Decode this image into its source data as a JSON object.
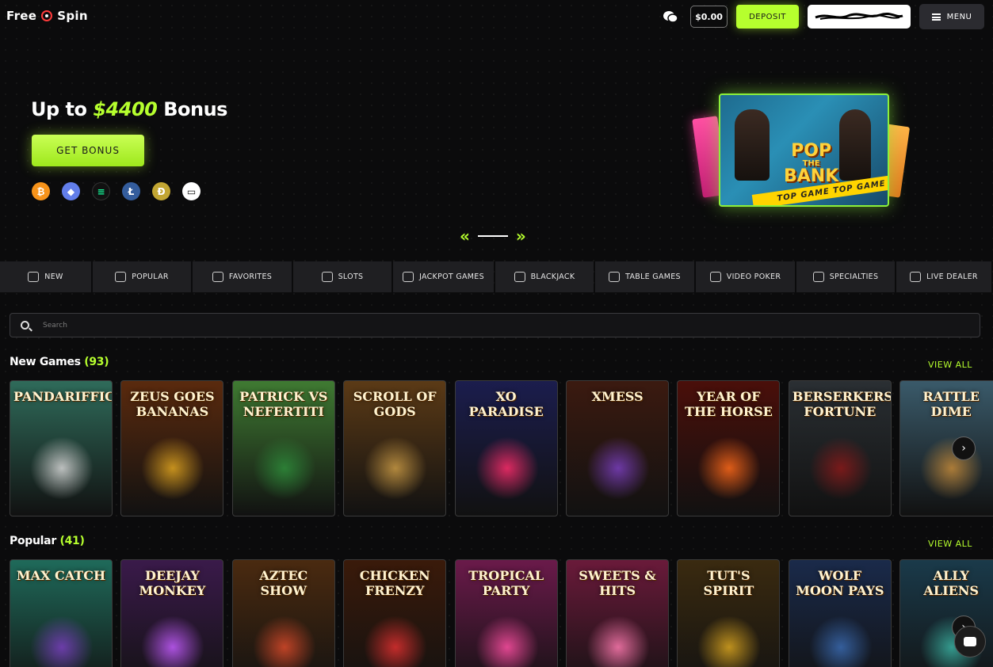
{
  "header": {
    "logo_left": "Free",
    "logo_right": "Spin",
    "balance": "$0.00",
    "deposit_label": "DEPOSIT",
    "menu_label": "MENU"
  },
  "hero": {
    "title_prefix": "Up to ",
    "title_amount": "$4400",
    "title_suffix": " Bonus",
    "cta_label": "GET BONUS",
    "payment_icons": [
      "bitcoin-icon",
      "ethereum-icon",
      "solana-icon",
      "litecoin-icon",
      "dogecoin-icon",
      "card-icon"
    ],
    "featured_game": {
      "line1": "POP",
      "line2": "THE",
      "line3": "BANK",
      "banner": "TOP GAME   TOP GAME"
    }
  },
  "tabs": [
    {
      "label": "NEW",
      "icon": "diamond-icon"
    },
    {
      "label": "POPULAR",
      "icon": "star-icon"
    },
    {
      "label": "FAVORITES",
      "icon": "heart-icon"
    },
    {
      "label": "SLOTS",
      "icon": "slots-icon"
    },
    {
      "label": "JACKPOT GAMES",
      "icon": "jackpot-icon"
    },
    {
      "label": "BLACKJACK",
      "icon": "cards-icon"
    },
    {
      "label": "TABLE GAMES",
      "icon": "table-icon"
    },
    {
      "label": "VIDEO POKER",
      "icon": "poker-chip-icon"
    },
    {
      "label": "SPECIALTIES",
      "icon": "specialties-icon"
    },
    {
      "label": "LIVE DEALER",
      "icon": "dealer-icon"
    }
  ],
  "search": {
    "placeholder": "Search"
  },
  "sections": [
    {
      "title": "New Games",
      "count": "(93)",
      "view_all": "VIEW ALL",
      "games": [
        {
          "title": "PANDARIFFIC",
          "bg": "#2f6b5a",
          "art": "#d8d8d8"
        },
        {
          "title": "ZEUS GOES BANANAS",
          "bg": "#5a2a0e",
          "art": "#e0a520"
        },
        {
          "title": "PATRICK VS NEFERTITI",
          "bg": "#3f7a32",
          "art": "#2e8b3a"
        },
        {
          "title": "SCROLL OF GODS",
          "bg": "#5b3a16",
          "art": "#c99a45"
        },
        {
          "title": "XO PARADISE",
          "bg": "#1b1d4d",
          "art": "#ff2d6b"
        },
        {
          "title": "XMESS",
          "bg": "#3b1a10",
          "art": "#7a3fbf"
        },
        {
          "title": "YEAR OF THE HORSE",
          "bg": "#4a0f0a",
          "art": "#ff6a1a"
        },
        {
          "title": "BERSERKERS FORTUNE",
          "bg": "#2a2f33",
          "art": "#8a1a1a"
        },
        {
          "title": "RATTLE DIME",
          "bg": "#3a5a6a",
          "art": "#c48a3a"
        }
      ]
    },
    {
      "title": "Popular",
      "count": "(41)",
      "view_all": "VIEW ALL",
      "games": [
        {
          "title": "MAX CATCH",
          "bg": "#1f6a5a",
          "art": "#7a3fbf"
        },
        {
          "title": "DEEJAY MONKEY",
          "bg": "#3a1a4a",
          "art": "#c45cff"
        },
        {
          "title": "AZTEC SHOW",
          "bg": "#4a2a10",
          "art": "#d94a2a"
        },
        {
          "title": "CHICKEN FRENZY",
          "bg": "#3a1a0a",
          "art": "#e03030"
        },
        {
          "title": "TROPICAL PARTY",
          "bg": "#6a1a4a",
          "art": "#ff4fa3"
        },
        {
          "title": "SWEETS & HITS",
          "bg": "#6a1a3a",
          "art": "#ff7ab0"
        },
        {
          "title": "TUT'S SPIRIT",
          "bg": "#3a2a10",
          "art": "#d9a520"
        },
        {
          "title": "WOLF MOON PAYS",
          "bg": "#1a2a4a",
          "art": "#3a6ab0"
        },
        {
          "title": "ALLY ALIENS",
          "bg": "#1a3a4a",
          "art": "#3ab0a0"
        }
      ]
    }
  ]
}
